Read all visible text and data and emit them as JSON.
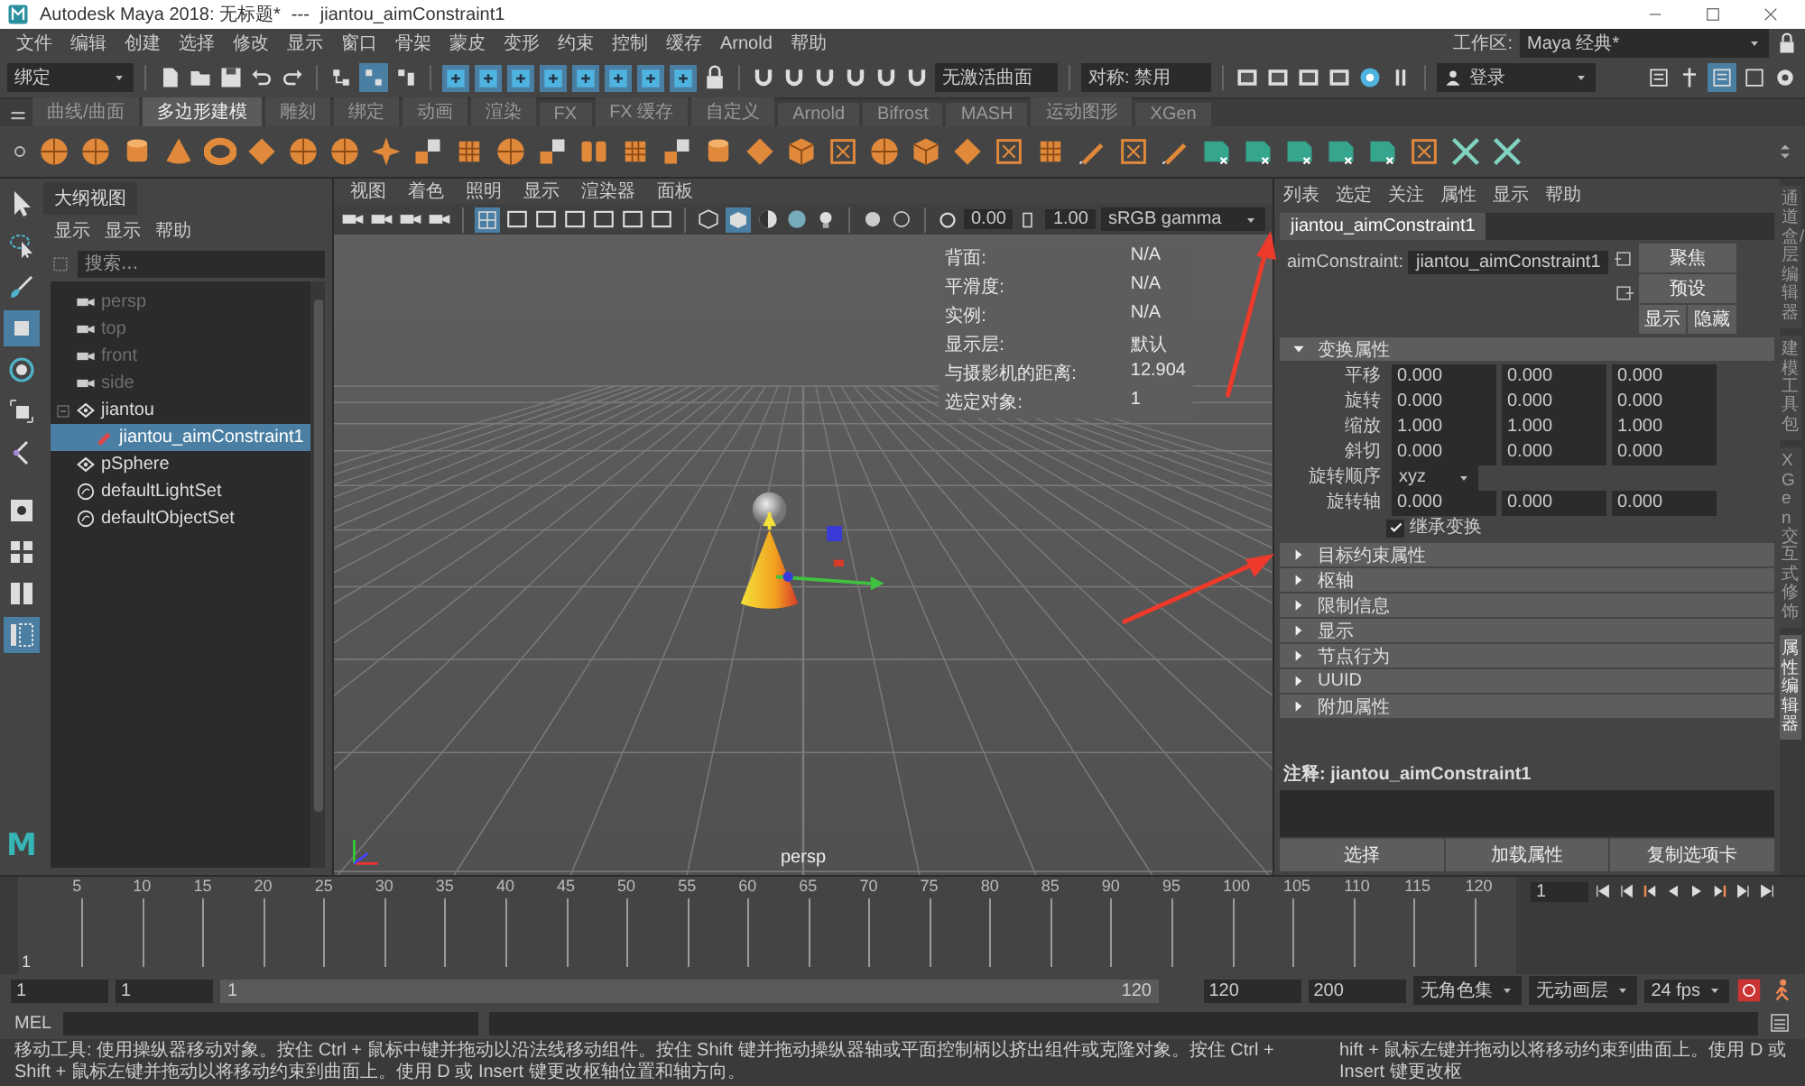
{
  "title_bar": {
    "app_title": "Autodesk Maya 2018: 无标题*",
    "separator": "---",
    "document": "jiantou_aimConstraint1"
  },
  "menu_bar": [
    "文件",
    "编辑",
    "创建",
    "选择",
    "修改",
    "显示",
    "窗口",
    "骨架",
    "蒙皮",
    "变形",
    "约束",
    "控制",
    "缓存",
    "Arnold",
    "帮助"
  ],
  "workspace": {
    "label": "工作区:",
    "value": "Maya 经典*"
  },
  "status_line": {
    "menu_set": "绑定",
    "live_surface": "无激活曲面",
    "symmetry": "对称: 禁用",
    "sign_in": "登录"
  },
  "shelf_tabs": [
    {
      "label": "曲线/曲面",
      "selected": false
    },
    {
      "label": "多边形建模",
      "selected": true
    },
    {
      "label": "雕刻",
      "selected": false
    },
    {
      "label": "绑定",
      "selected": false
    },
    {
      "label": "动画",
      "selected": false
    },
    {
      "label": "渲染",
      "selected": false
    },
    {
      "label": "FX",
      "selected": false
    },
    {
      "label": "FX 缓存",
      "selected": false
    },
    {
      "label": "自定义",
      "selected": false
    },
    {
      "label": "Arnold",
      "selected": false
    },
    {
      "label": "Bifrost",
      "selected": false
    },
    {
      "label": "MASH",
      "selected": false
    },
    {
      "label": "运动图形",
      "selected": false
    },
    {
      "label": "XGen",
      "selected": false
    }
  ],
  "toolbox": [
    {
      "kind": "select",
      "selected": false
    },
    {
      "kind": "lasso",
      "selected": false
    },
    {
      "kind": "paint",
      "selected": false
    },
    {
      "kind": "move",
      "selected": true
    },
    {
      "kind": "rotate",
      "selected": false
    },
    {
      "kind": "scale",
      "selected": false
    },
    {
      "kind": "last",
      "selected": false
    },
    {
      "kind": "single",
      "selected": false
    },
    {
      "kind": "four",
      "selected": false
    },
    {
      "kind": "side",
      "selected": false
    },
    {
      "kind": "outliner",
      "selected": true
    }
  ],
  "logo": "M",
  "outliner": {
    "title": "大纲视图",
    "menu": [
      "显示",
      "显示",
      "帮助"
    ],
    "search": {
      "placeholder": "搜索..."
    },
    "items": [
      {
        "name": "persp",
        "kind": "camera",
        "dimmed": true,
        "selected": false
      },
      {
        "name": "top",
        "kind": "camera",
        "dimmed": true,
        "selected": false
      },
      {
        "name": "front",
        "kind": "camera",
        "dimmed": true,
        "selected": false
      },
      {
        "name": "side",
        "kind": "camera",
        "dimmed": true,
        "selected": false
      },
      {
        "name": "jiantou",
        "kind": "transform",
        "dimmed": false,
        "selected": false,
        "expanded": true,
        "children": [
          {
            "name": "jiantou_aimConstraint1",
            "kind": "constraint",
            "dimmed": false,
            "selected": true
          }
        ]
      },
      {
        "name": "pSphere",
        "kind": "transform",
        "dimmed": false,
        "selected": false
      },
      {
        "name": "defaultLightSet",
        "kind": "set",
        "dimmed": false,
        "selected": false
      },
      {
        "name": "defaultObjectSet",
        "kind": "set",
        "dimmed": false,
        "selected": false
      }
    ]
  },
  "viewport": {
    "menu": [
      "视图",
      "着色",
      "照明",
      "显示",
      "渲染器",
      "面板"
    ],
    "exposure": "0.00",
    "gamma": "1.00",
    "color_space": "sRGB gamma",
    "hud": [
      {
        "label": "背面:",
        "value": "N/A"
      },
      {
        "label": "平滑度:",
        "value": "N/A"
      },
      {
        "label": "实例:",
        "value": "N/A"
      },
      {
        "label": "显示层:",
        "value": "默认"
      },
      {
        "label": "与摄影机的距离:",
        "value": "12.904"
      },
      {
        "label": "选定对象:",
        "value": "1"
      }
    ],
    "camera": "persp"
  },
  "attribute_editor": {
    "menu": [
      "列表",
      "选定",
      "关注",
      "属性",
      "显示",
      "帮助"
    ],
    "node_tab": {
      "label": "jiantou_aimConstraint1",
      "selected": true
    },
    "node_type": "aimConstraint:",
    "node_name": "jiantou_aimConstraint1",
    "buttons": [
      "聚焦",
      "预设",
      "显示",
      "隐藏"
    ],
    "sections": [
      {
        "title": "变换属性",
        "expanded": true,
        "rows": [
          {
            "kind": "vector",
            "label": "平移",
            "values": [
              "0.000",
              "0.000",
              "0.000"
            ]
          },
          {
            "kind": "vector",
            "label": "旋转",
            "values": [
              "0.000",
              "0.000",
              "0.000"
            ]
          },
          {
            "kind": "vector",
            "label": "缩放",
            "values": [
              "1.000",
              "1.000",
              "1.000"
            ]
          },
          {
            "kind": "vector",
            "label": "斜切",
            "values": [
              "0.000",
              "0.000",
              "0.000"
            ]
          },
          {
            "kind": "enum",
            "label": "旋转顺序",
            "value": "xyz"
          },
          {
            "kind": "vector",
            "label": "旋转轴",
            "values": [
              "0.000",
              "0.000",
              "0.000"
            ]
          },
          {
            "kind": "checkbox",
            "label": "继承变换",
            "checked": true
          }
        ]
      },
      {
        "title": "目标约束属性",
        "expanded": false
      },
      {
        "title": "枢轴",
        "expanded": false
      },
      {
        "title": "限制信息",
        "expanded": false
      },
      {
        "title": "显示",
        "expanded": false
      },
      {
        "title": "节点行为",
        "expanded": false
      },
      {
        "title": "UUID",
        "expanded": false
      },
      {
        "title": "附加属性",
        "expanded": false
      }
    ],
    "notes": "注释: jiantou_aimConstraint1",
    "bottom_buttons": [
      "选择",
      "加载属性",
      "复制选项卡"
    ]
  },
  "side_tabs": [
    {
      "label": "通道盒/层编辑器",
      "selected": false
    },
    {
      "label": "建模工具包",
      "selected": false
    },
    {
      "label": "XGen 交互式修饰",
      "selected": false
    },
    {
      "label": "属性编辑器",
      "selected": true
    }
  ],
  "timeline": {
    "ticks": [
      "5",
      "10",
      "15",
      "20",
      "25",
      "30",
      "35",
      "40",
      "45",
      "50",
      "55",
      "60",
      "65",
      "70",
      "75",
      "80",
      "85",
      "90",
      "95",
      "100",
      "105",
      "110",
      "115",
      "120"
    ],
    "start_frame": "1",
    "current_frame": "1"
  },
  "range": {
    "level": 1,
    "start": "1",
    "range_start": "1",
    "slider_start": "1",
    "slider_end": "120",
    "range_end": "120",
    "end": "200",
    "character_set": "无角色集",
    "anim_layer": "无动画层",
    "fps": "24 fps"
  },
  "command_line": {
    "language": "MEL"
  },
  "help_line": [
    "移动工具: 使用操纵器移动对象。按住 Ctrl + 鼠标中键并拖动以沿法线移动组件。按住 Shift 键并拖动操纵器轴或平面控制柄以挤出组件或克隆对象。按住 Ctrl + Shift + 鼠标左键并拖动以将移动约束到曲面上。使用 D 或 Insert 键更改枢轴位置和轴方向。",
    "hift + 鼠标左键并拖动以将移动约束到曲面上。使用 D 或 Insert 键更改枢"
  ]
}
